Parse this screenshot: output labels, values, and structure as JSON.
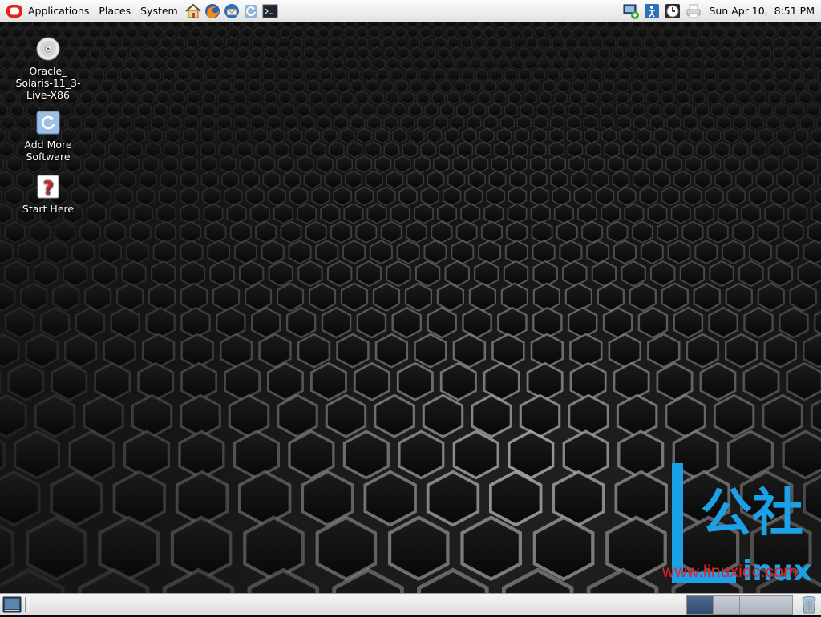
{
  "top_panel": {
    "menus": [
      "Applications",
      "Places",
      "System"
    ],
    "launchers": [
      "home-folder-icon",
      "firefox-icon",
      "thunderbird-icon",
      "update-icon",
      "terminal-icon"
    ],
    "tray_icons": [
      "network-manager-icon",
      "accessibility-icon",
      "time-slider-icon",
      "printer-icon"
    ],
    "clock": "Sun Apr 10,  8:51 PM"
  },
  "desktop": {
    "icons": [
      {
        "name": "dvd-icon",
        "label": "Oracle_\nSolaris-11_3-\nLive-X86"
      },
      {
        "name": "package-manager-icon",
        "label": "Add More\nSoftware"
      },
      {
        "name": "help-icon",
        "label": "Start Here"
      }
    ],
    "watermark": {
      "chars": "公社",
      "word": "inux",
      "url": "www.linuxidc.com"
    }
  },
  "bottom_panel": {
    "workspace_count": 4,
    "active_workspace": 1
  },
  "colors": {
    "panel_light": "#fbfbfb",
    "panel_dark": "#e2e2e2",
    "watermark_blue": "#1da1e6",
    "watermark_red": "#e52127",
    "oracle_red": "#e2231a"
  }
}
